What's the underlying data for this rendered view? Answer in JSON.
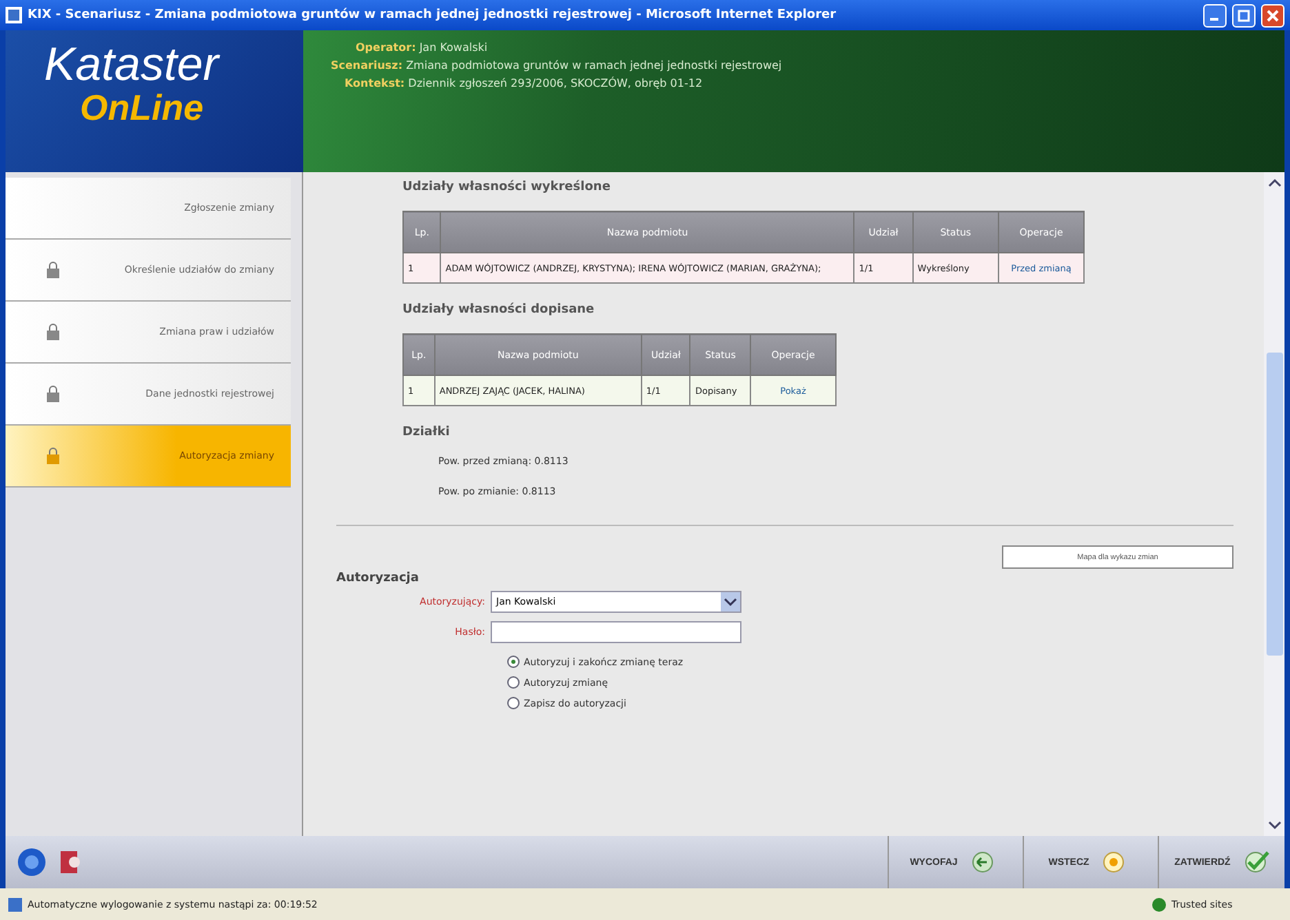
{
  "window": {
    "title": "KIX - Scenariusz - Zmiana podmiotowa gruntów w ramach jednej jednostki rejestrowej - Microsoft Internet Explorer"
  },
  "logo": {
    "line_1": "Kataster",
    "line_2": "OnLine"
  },
  "header": [
    {
      "label": "Operator:",
      "value": "Jan Kowalski"
    },
    {
      "label": "Scenariusz:",
      "value": "Zmiana podmiotowa gruntów w ramach jednej jednostki rejestrowej"
    },
    {
      "label": "Kontekst:",
      "value": "Dziennik zgłoszeń 293/2006, SKOCZÓW, obręb 01-12"
    }
  ],
  "sidebar": {
    "items": [
      {
        "label": "Zgłoszenie zmiany",
        "locked": false,
        "selected": false
      },
      {
        "label": "Określenie udziałów do zmiany",
        "locked": true,
        "selected": false
      },
      {
        "label": "Zmiana praw i udziałów",
        "locked": true,
        "selected": false
      },
      {
        "label": "Dane jednostki rejestrowej",
        "locked": true,
        "selected": false
      },
      {
        "label": "Autoryzacja zmiany",
        "locked": true,
        "selected": true
      }
    ]
  },
  "sections": [
    {
      "title": "Udziały własności wykreślone",
      "kind": "removed",
      "columns": [
        "Lp.",
        "Nazwa podmiotu",
        "Udział",
        "Status",
        "Operacje"
      ],
      "rows": [
        [
          "1",
          "ADAM WÓJTOWICZ (ANDRZEJ, KRYSTYNA); IRENA WÓJTOWICZ (MARIAN, GRAŻYNA);",
          "1/1",
          "Wykreślony",
          "Przed zmianą"
        ]
      ]
    },
    {
      "title": "Udziały własności dopisane",
      "kind": "added",
      "columns": [
        "Lp.",
        "Nazwa podmiotu",
        "Udział",
        "Status",
        "Operacje"
      ],
      "rows": [
        [
          "1",
          "ANDRZEJ ZAJĄC (JACEK, HALINA)",
          "1/1",
          "Dopisany",
          "Pokaż"
        ]
      ]
    }
  ],
  "parcels": {
    "title": "Działki",
    "lines": [
      "Pow. przed zmianą: 0.8113",
      "Pow. po zmianie: 0.8113"
    ]
  },
  "map_button": "Mapa dla wykazu zmian",
  "authorization": {
    "title": "Autoryzacja",
    "authorizer_label": "Autoryzujący:",
    "authorizer_value": "Jan Kowalski",
    "password_label": "Hasło:",
    "options": [
      {
        "label": "Autoryzuj i zakończ zmianę teraz",
        "selected": true
      },
      {
        "label": "Autoryzuj zmianę",
        "selected": false
      },
      {
        "label": "Zapisz do autoryzacji",
        "selected": false
      }
    ]
  },
  "toolbar": {
    "buttons": [
      {
        "label": "WYCOFAJ",
        "kind": "back"
      },
      {
        "label": "WSTECZ",
        "kind": "previous"
      },
      {
        "label": "ZATWIERDŹ",
        "kind": "confirm"
      }
    ]
  },
  "status_bar": {
    "message": "Automatyczne wylogowanie z systemu nastąpi za:  00:19:52",
    "zone": "Trusted sites"
  }
}
